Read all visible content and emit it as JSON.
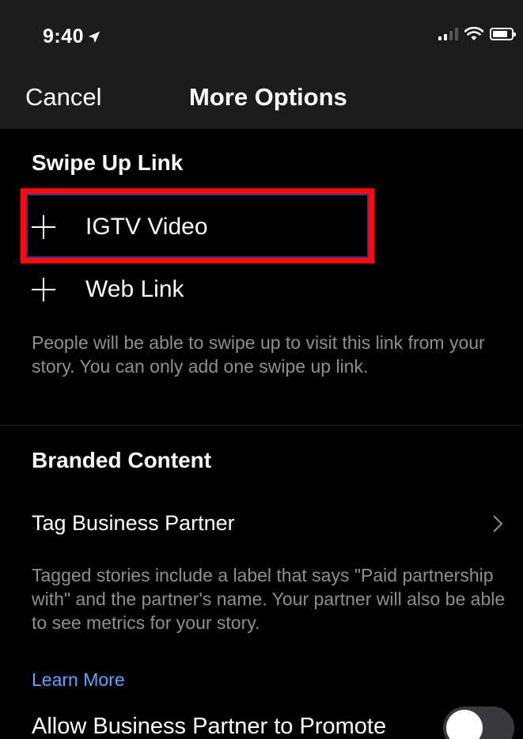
{
  "status_bar": {
    "time": "9:40",
    "location_icon": "location-arrow-icon",
    "signal_icon": "cellular-signal-icon",
    "wifi_icon": "wifi-icon",
    "battery_icon": "battery-icon"
  },
  "nav": {
    "cancel_label": "Cancel",
    "title": "More Options"
  },
  "swipe_up": {
    "title": "Swipe Up Link",
    "options": [
      {
        "label": "IGTV Video",
        "icon": "plus-icon"
      },
      {
        "label": "Web Link",
        "icon": "plus-icon"
      }
    ],
    "description": "People will be able to swipe up to visit this link from your story. You can only add one swipe up link."
  },
  "branded": {
    "title": "Branded Content",
    "tag_partner_label": "Tag Business Partner",
    "description": "Tagged stories include a label that says \"Paid partnership with\" and the partner's name. Your partner will also be able to see metrics for your story.",
    "learn_more": "Learn More",
    "allow_promote_label": "Allow Business Partner to Promote",
    "allow_promote_enabled": false
  },
  "colors": {
    "background": "#000000",
    "topbar": "#1c1c1e",
    "secondary_text": "#8e8e93",
    "link": "#5aa5ff",
    "highlight_border": "#ff0a0a"
  }
}
